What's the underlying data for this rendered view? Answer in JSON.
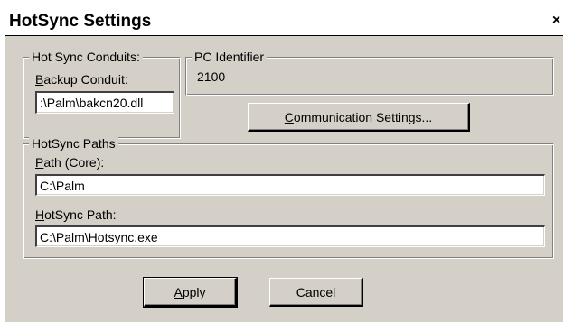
{
  "window": {
    "title": "HotSync Settings",
    "close_glyph": "×"
  },
  "conduits": {
    "legend": "Hot Sync Conduits:",
    "backup_label_mnemonic": "B",
    "backup_label_rest": "ackup Conduit:",
    "backup_value": ":\\Palm\\bakcn20.dll"
  },
  "pc_identifier": {
    "legend": "PC Identifier",
    "value": "2100"
  },
  "comm_button": {
    "mnemonic": "C",
    "rest": "ommunication Settings..."
  },
  "paths": {
    "legend": "HotSync Paths",
    "core_label_mnemonic": "P",
    "core_label_rest": "ath (Core):",
    "core_value": "C:\\Palm",
    "hotsync_label_mnemonic": "H",
    "hotsync_label_rest": "otSync Path:",
    "hotsync_value": "C:\\Palm\\Hotsync.exe"
  },
  "buttons": {
    "apply_mnemonic": "A",
    "apply_rest": "pply",
    "cancel": "Cancel"
  }
}
